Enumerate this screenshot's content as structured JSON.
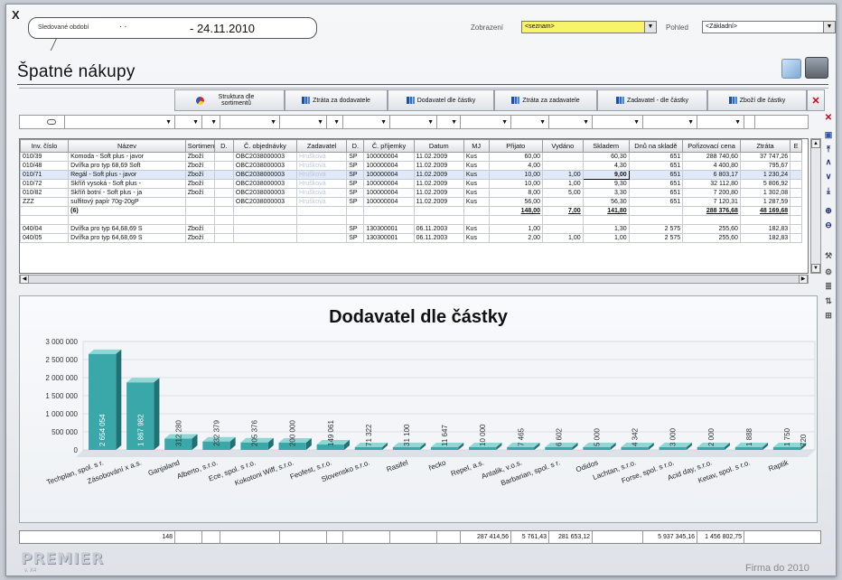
{
  "window": {
    "close_label": "X"
  },
  "period": {
    "label": "Sledované období",
    "dots": ". .",
    "date": "- 24.11.2010"
  },
  "zobrazeni": {
    "label": "Zobrazení",
    "value": "<seznam>"
  },
  "pohled": {
    "label": "Pohled",
    "value": "<Základní>"
  },
  "page_title": "Špatné nákupy",
  "analysis_buttons": [
    {
      "label": "Struktura dle sortimentů",
      "icon": "pie-chart-icon"
    },
    {
      "label": "Ztráta za dodavatele",
      "icon": "bar-chart-icon"
    },
    {
      "label": "Dodavatel dle částky",
      "icon": "bar-chart-icon"
    },
    {
      "label": "Ztráta za zadavatele",
      "icon": "bar-chart-icon"
    },
    {
      "label": "Zadavatel - dle částky",
      "icon": "bar-chart-icon"
    },
    {
      "label": "Zboží dle částky",
      "icon": "bar-chart-icon"
    }
  ],
  "table": {
    "columns": [
      "Inv. číslo",
      "Název",
      "Sortiment",
      "D.",
      "Č. objednávky",
      "Zadavatel",
      "D.",
      "Č. příjemky",
      "Datum",
      "MJ",
      "Přijato",
      "Vydáno",
      "Skladem",
      "Dnů na skladě",
      "Pořizovací cena",
      "Ztráta",
      "E"
    ],
    "rows": [
      [
        "010/39",
        "Komoda - Soft plus - javor",
        "Zboží",
        "",
        "OBC2038000003",
        "Hrušková",
        "SP",
        "100000004",
        "11.02.2009",
        "Kus",
        "60,00",
        "",
        "60,30",
        "651",
        "288 740,60",
        "37 747,26",
        ""
      ],
      [
        "010/48",
        "Dvířka pro typ 68,69 Soft",
        "Zboží",
        "",
        "OBC2038000003",
        "Hrušková",
        "SP",
        "100000004",
        "11.02.2009",
        "Kus",
        "4,00",
        "",
        "4,30",
        "651",
        "4 400,80",
        "795,67",
        ""
      ],
      [
        "010/71",
        "Regál - Soft plus - javor",
        "Zboží",
        "",
        "OBC2038000003",
        "Hrušková",
        "SP",
        "100000004",
        "11.02.2009",
        "Kus",
        "10,00",
        "1,00",
        "9,00",
        "651",
        "6 803,17",
        "1 230,24",
        ""
      ],
      [
        "010/72",
        "Skříň vysoká - Soft plus -",
        "Zboží",
        "",
        "OBC2038000003",
        "Hrušková",
        "SP",
        "100000004",
        "11.02.2009",
        "Kus",
        "10,00",
        "1,00",
        "9,30",
        "651",
        "32 112,80",
        "5 806,92",
        ""
      ],
      [
        "010/82",
        "Skříň botní - Soft plus - ja",
        "Zboží",
        "",
        "OBC2038000003",
        "Hrušková",
        "SP",
        "100000004",
        "11.02.2009",
        "Kus",
        "8,00",
        "5,00",
        "3,30",
        "651",
        "7 200,80",
        "1 302,08",
        ""
      ],
      [
        "ZZZ",
        "sulfitový papír 70g-20gP",
        "",
        "",
        "OBC2038000003",
        "Hrušková",
        "SP",
        "100000004",
        "11.02.2009",
        "Kus",
        "56,00",
        "",
        "56,30",
        "651",
        "7 120,31",
        "1 287,59",
        ""
      ],
      [
        "",
        "(6)",
        "",
        "",
        "",
        "",
        "",
        "",
        "",
        "",
        "148,00",
        "7,00",
        "141,80",
        "",
        "288 376,68",
        "48 169,68",
        ""
      ],
      [
        "",
        "",
        "",
        "",
        "",
        "",
        "",
        "",
        "",
        "",
        "",
        "",
        "",
        "",
        "",
        "",
        ""
      ],
      [
        "040/04",
        "Dvířka pro typ 64,68,69 S",
        "Zboží",
        "",
        "",
        "",
        "SP",
        "130300001",
        "06.11.2003",
        "Kus",
        "1,00",
        "",
        "1,30",
        "2 575",
        "255,60",
        "182,83",
        ""
      ],
      [
        "040/05",
        "Dvířka pro typ 64,68,69 S",
        "Zboží",
        "",
        "",
        "",
        "SP",
        "130300001",
        "06.11.2003",
        "Kus",
        "2,00",
        "1,00",
        "1,00",
        "2 575",
        "255,60",
        "182,83",
        ""
      ]
    ]
  },
  "chart_data": {
    "type": "bar",
    "title": "Dodavatel dle částky",
    "xlabel": "",
    "ylabel": "",
    "ylim": [
      0,
      3000000
    ],
    "yticks": [
      "3 000 000",
      "2 500 000",
      "2 000 000",
      "1 500 000",
      "1 000 000",
      "500 000",
      "0"
    ],
    "categories": [
      "Techplan, spol. s r.",
      "Zásobování x a.s.",
      "Ganjaland",
      "Alberto, s.r.o.",
      "Ece, spol. s r.o.",
      "Kokotoni Wiff, s.r.o.",
      "Feofest, s.r.o.",
      "Slovensko s.r.o.",
      "Rasifel",
      "řecko",
      "Repel, a.s.",
      "Antalik, v.o.s.",
      "Barbarian, spol. s r.",
      "Odidos",
      "Lachtan, s.r.o.",
      "Forse, spol. s r.o.",
      "Acid day, s.r.o.",
      "Ketav, spol. s r.o.",
      "Raptik"
    ],
    "values": [
      2654054,
      1867982,
      312280,
      232379,
      205376,
      200000,
      149061,
      71322,
      31100,
      11647,
      10000,
      7465,
      6602,
      5000,
      4342,
      3000,
      2000,
      1888,
      1750
    ],
    "labels": [
      "2 654 054",
      "1 867 982",
      "312 280",
      "232 379",
      "205 376",
      "200 000",
      "149 061",
      "71 322",
      "31 100",
      "11 647",
      "10 000",
      "7 465",
      "6 602",
      "5 000",
      "4 342",
      "3 000",
      "2 000",
      "1 888",
      "1 750",
      "720"
    ],
    "colors": {
      "bar_front": "#3aa7a9",
      "bar_top": "#8fd6d4",
      "bar_side": "#1f7173"
    }
  },
  "totals": {
    "count": "148",
    "prijato": "287 414,56",
    "vydano": "5 761,43",
    "skladem": "281 653,12",
    "porizovaci": "5 937 345,16",
    "ztrata": "1 456 802,75"
  },
  "footer": {
    "logo": "PREMIER",
    "version": "v. X4",
    "firm": "Firma do 2010"
  }
}
